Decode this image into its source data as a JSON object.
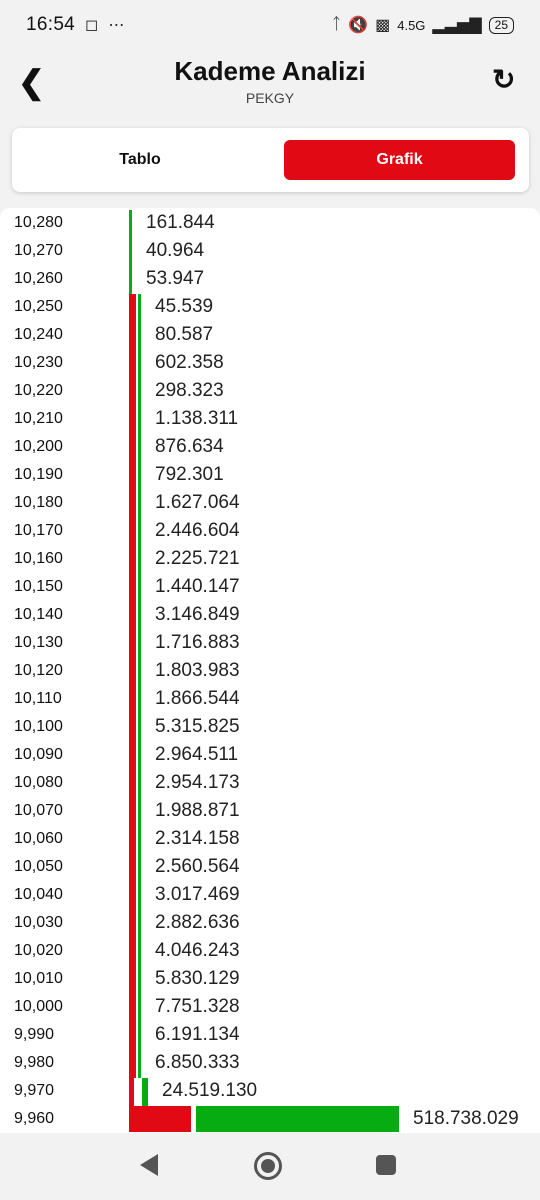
{
  "status_bar": {
    "time": "16:54",
    "left_icons": [
      "instagram-icon",
      "more-dots-icon"
    ],
    "right_icons": [
      "bluetooth-icon",
      "mute-icon",
      "volte-icon",
      "signal-icon"
    ],
    "network": "4.5G",
    "battery": "25"
  },
  "header": {
    "title": "Kademe Analizi",
    "subtitle": "PEKGY",
    "back_icon": "chevron-left-icon",
    "refresh_icon": "refresh-icon"
  },
  "tabs": [
    {
      "label": "Tablo",
      "active": false
    },
    {
      "label": "Grafik",
      "active": true
    }
  ],
  "colors": {
    "accent": "#e10914",
    "sell": "#e10914",
    "buy": "#07ac12"
  },
  "chart_data": {
    "type": "bar",
    "orientation": "horizontal",
    "series_colors": [
      "#e10914",
      "#07ac12"
    ],
    "levels": [
      {
        "price": "10,280",
        "volume": "161.844"
      },
      {
        "price": "10,270",
        "volume": "40.964"
      },
      {
        "price": "10,260",
        "volume": "53.947"
      },
      {
        "price": "10,250",
        "volume": "45.539"
      },
      {
        "price": "10,240",
        "volume": "80.587"
      },
      {
        "price": "10,230",
        "volume": "602.358"
      },
      {
        "price": "10,220",
        "volume": "298.323"
      },
      {
        "price": "10,210",
        "volume": "1.138.311"
      },
      {
        "price": "10,200",
        "volume": "876.634"
      },
      {
        "price": "10,190",
        "volume": "792.301"
      },
      {
        "price": "10,180",
        "volume": "1.627.064"
      },
      {
        "price": "10,170",
        "volume": "2.446.604"
      },
      {
        "price": "10,160",
        "volume": "2.225.721"
      },
      {
        "price": "10,150",
        "volume": "1.440.147"
      },
      {
        "price": "10,140",
        "volume": "3.146.849"
      },
      {
        "price": "10,130",
        "volume": "1.716.883"
      },
      {
        "price": "10,120",
        "volume": "1.803.983"
      },
      {
        "price": "10,110",
        "volume": "1.866.544"
      },
      {
        "price": "10,100",
        "volume": "5.315.825"
      },
      {
        "price": "10,090",
        "volume": "2.964.511"
      },
      {
        "price": "10,080",
        "volume": "2.954.173"
      },
      {
        "price": "10,070",
        "volume": "1.988.871"
      },
      {
        "price": "10,060",
        "volume": "2.314.158"
      },
      {
        "price": "10,050",
        "volume": "2.560.564"
      },
      {
        "price": "10,040",
        "volume": "3.017.469"
      },
      {
        "price": "10,030",
        "volume": "2.882.636"
      },
      {
        "price": "10,020",
        "volume": "4.046.243"
      },
      {
        "price": "10,010",
        "volume": "5.830.129"
      },
      {
        "price": "10,000",
        "volume": "7.751.328"
      },
      {
        "price": "9,990",
        "volume": "6.191.134"
      },
      {
        "price": "9,980",
        "volume": "6.850.333"
      },
      {
        "price": "9,970",
        "volume": "24.519.130"
      },
      {
        "price": "9,960",
        "volume": "518.738.029"
      }
    ]
  }
}
